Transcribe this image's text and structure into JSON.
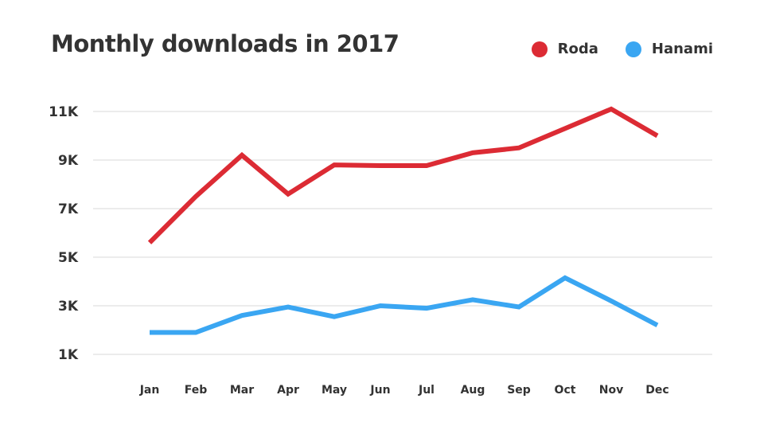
{
  "chart_data": {
    "type": "line",
    "title": "Monthly downloads in 2017",
    "xlabel": "",
    "ylabel": "",
    "categories": [
      "Jan",
      "Feb",
      "Mar",
      "Apr",
      "May",
      "Jun",
      "Jul",
      "Aug",
      "Sep",
      "Oct",
      "Nov",
      "Dec"
    ],
    "series": [
      {
        "name": "Roda",
        "color": "#dc2b34",
        "values": [
          5600,
          7500,
          9200,
          7600,
          8800,
          8770,
          8770,
          9300,
          9500,
          10300,
          11100,
          10000
        ]
      },
      {
        "name": "Hanami",
        "color": "#3aa6f2",
        "values": [
          1900,
          1900,
          2600,
          2950,
          2550,
          3000,
          2900,
          3250,
          2950,
          4150,
          3200,
          2200
        ]
      }
    ],
    "ylim": [
      1000,
      11000
    ],
    "yticks": [
      1000,
      3000,
      5000,
      7000,
      9000,
      11000
    ],
    "ytick_labels": [
      "1K",
      "3K",
      "5K",
      "7K",
      "9K",
      "11K"
    ],
    "grid": true,
    "legend_position": "top-right"
  }
}
